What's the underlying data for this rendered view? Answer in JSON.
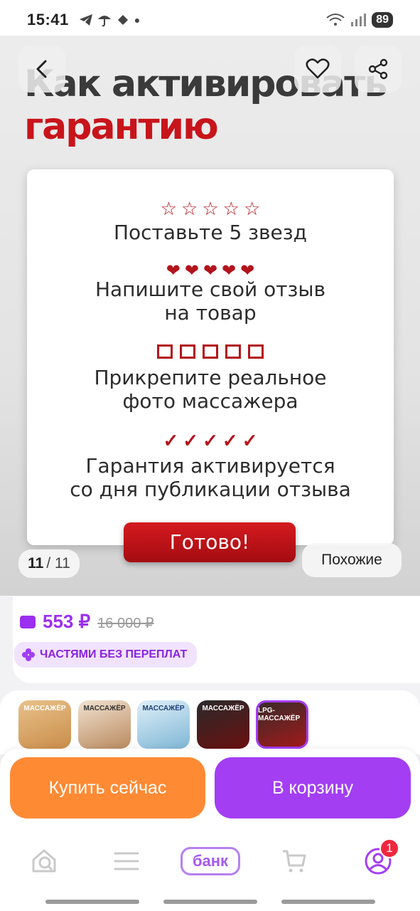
{
  "status_bar": {
    "time": "15:41",
    "battery": "89",
    "notifications": [
      "telegram-icon",
      "umbrella-icon",
      "vk-icon",
      "dot-icon"
    ]
  },
  "gallery": {
    "promo_title_line1": "Как активировать",
    "promo_title_line2": "гарантию",
    "steps": [
      {
        "icon": "star-icon",
        "line1": "Поставьте 5 звезд",
        "line2": ""
      },
      {
        "icon": "heart-icon",
        "line1": "Напишите свой отзыв",
        "line2": "на товар"
      },
      {
        "icon": "square-icon",
        "line1": "Прикрепите реальное",
        "line2": "фото массажера"
      },
      {
        "icon": "check-icon",
        "line1": "Гарантия активируется",
        "line2": "со дня публикации отзыва"
      }
    ],
    "done_label": "Готово!",
    "counter_current": "11",
    "counter_total": "/ 11",
    "similar_label": "Похожие"
  },
  "price": {
    "current": "553 ₽",
    "old": "16 000 ₽",
    "installments": "ЧАСТЯМИ БЕЗ ПЕРЕПЛАТ"
  },
  "thumbnails": [
    {
      "label": "МАССАЖЁР",
      "selected": false
    },
    {
      "label": "МАССАЖЁР",
      "selected": false
    },
    {
      "label": "МАССАЖЁР",
      "selected": false
    },
    {
      "label": "МАССАЖЁР",
      "selected": false
    },
    {
      "label": "LPG-МАССАЖЁР",
      "selected": true
    }
  ],
  "actions": {
    "buy_now": "Купить сейчас",
    "to_cart": "В корзину"
  },
  "bottom_nav": {
    "bank_label": "банк",
    "profile_badge": "1"
  },
  "colors": {
    "accent_purple": "#a33ef3",
    "accent_orange": "#ff8a34",
    "promo_red": "#c8141b"
  }
}
